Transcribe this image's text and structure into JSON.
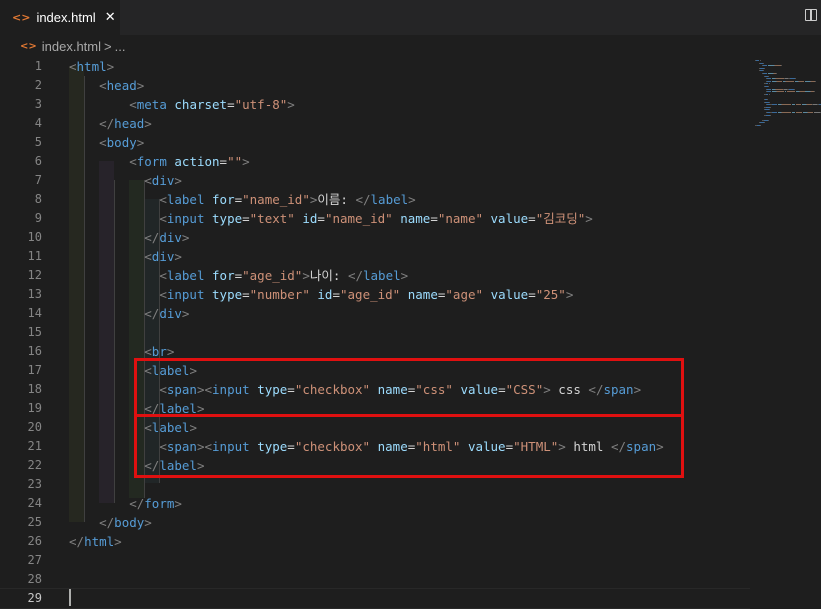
{
  "tab": {
    "icon": "html-file-icon",
    "icon_glyph": "<>",
    "label": "index.html",
    "close": "✕"
  },
  "breadcrumb": {
    "file": "index.html",
    "separator": ">",
    "more": "..."
  },
  "colors": {
    "tag": "#569cd6",
    "attr": "#9cdcfe",
    "string": "#ce9178",
    "punct": "#808080",
    "text": "#d4d4d4",
    "highlight": "#e01010"
  },
  "editor": {
    "lines": [
      {
        "n": "1",
        "tokens": [
          [
            "p",
            "<"
          ],
          [
            "t",
            "html"
          ],
          [
            "p",
            ">"
          ]
        ]
      },
      {
        "n": "2",
        "tokens": [
          [
            "x",
            "    "
          ],
          [
            "p",
            "<"
          ],
          [
            "t",
            "head"
          ],
          [
            "p",
            ">"
          ]
        ]
      },
      {
        "n": "3",
        "tokens": [
          [
            "x",
            "        "
          ],
          [
            "p",
            "<"
          ],
          [
            "t",
            "meta"
          ],
          [
            "x",
            " "
          ],
          [
            "a",
            "charset"
          ],
          [
            "x",
            "="
          ],
          [
            "s",
            "\"utf-8\""
          ],
          [
            "p",
            ">"
          ]
        ]
      },
      {
        "n": "4",
        "tokens": [
          [
            "x",
            "    "
          ],
          [
            "p",
            "</"
          ],
          [
            "t",
            "head"
          ],
          [
            "p",
            ">"
          ]
        ]
      },
      {
        "n": "5",
        "tokens": [
          [
            "x",
            "    "
          ],
          [
            "p",
            "<"
          ],
          [
            "t",
            "body"
          ],
          [
            "p",
            ">"
          ]
        ]
      },
      {
        "n": "6",
        "tokens": [
          [
            "x",
            "        "
          ],
          [
            "p",
            "<"
          ],
          [
            "t",
            "form"
          ],
          [
            "x",
            " "
          ],
          [
            "a",
            "action"
          ],
          [
            "x",
            "="
          ],
          [
            "s",
            "\"\""
          ],
          [
            "p",
            ">"
          ]
        ]
      },
      {
        "n": "7",
        "tokens": [
          [
            "x",
            "          "
          ],
          [
            "p",
            "<"
          ],
          [
            "t",
            "div"
          ],
          [
            "p",
            ">"
          ]
        ]
      },
      {
        "n": "8",
        "tokens": [
          [
            "x",
            "            "
          ],
          [
            "p",
            "<"
          ],
          [
            "t",
            "label"
          ],
          [
            "x",
            " "
          ],
          [
            "a",
            "for"
          ],
          [
            "x",
            "="
          ],
          [
            "s",
            "\"name_id\""
          ],
          [
            "p",
            ">"
          ],
          [
            "x",
            "이름: "
          ],
          [
            "p",
            "</"
          ],
          [
            "t",
            "label"
          ],
          [
            "p",
            ">"
          ]
        ]
      },
      {
        "n": "9",
        "tokens": [
          [
            "x",
            "            "
          ],
          [
            "p",
            "<"
          ],
          [
            "t",
            "input"
          ],
          [
            "x",
            " "
          ],
          [
            "a",
            "type"
          ],
          [
            "x",
            "="
          ],
          [
            "s",
            "\"text\""
          ],
          [
            "x",
            " "
          ],
          [
            "a",
            "id"
          ],
          [
            "x",
            "="
          ],
          [
            "s",
            "\"name_id\""
          ],
          [
            "x",
            " "
          ],
          [
            "a",
            "name"
          ],
          [
            "x",
            "="
          ],
          [
            "s",
            "\"name\""
          ],
          [
            "x",
            " "
          ],
          [
            "a",
            "value"
          ],
          [
            "x",
            "="
          ],
          [
            "s",
            "\"김코딩\""
          ],
          [
            "p",
            ">"
          ]
        ]
      },
      {
        "n": "10",
        "tokens": [
          [
            "x",
            "          "
          ],
          [
            "p",
            "</"
          ],
          [
            "t",
            "div"
          ],
          [
            "p",
            ">"
          ]
        ]
      },
      {
        "n": "11",
        "tokens": [
          [
            "x",
            "          "
          ],
          [
            "p",
            "<"
          ],
          [
            "t",
            "div"
          ],
          [
            "p",
            ">"
          ]
        ]
      },
      {
        "n": "12",
        "tokens": [
          [
            "x",
            "            "
          ],
          [
            "p",
            "<"
          ],
          [
            "t",
            "label"
          ],
          [
            "x",
            " "
          ],
          [
            "a",
            "for"
          ],
          [
            "x",
            "="
          ],
          [
            "s",
            "\"age_id\""
          ],
          [
            "p",
            ">"
          ],
          [
            "x",
            "나이: "
          ],
          [
            "p",
            "</"
          ],
          [
            "t",
            "label"
          ],
          [
            "p",
            ">"
          ]
        ]
      },
      {
        "n": "13",
        "tokens": [
          [
            "x",
            "            "
          ],
          [
            "p",
            "<"
          ],
          [
            "t",
            "input"
          ],
          [
            "x",
            " "
          ],
          [
            "a",
            "type"
          ],
          [
            "x",
            "="
          ],
          [
            "s",
            "\"number\""
          ],
          [
            "x",
            " "
          ],
          [
            "a",
            "id"
          ],
          [
            "x",
            "="
          ],
          [
            "s",
            "\"age_id\""
          ],
          [
            "x",
            " "
          ],
          [
            "a",
            "name"
          ],
          [
            "x",
            "="
          ],
          [
            "s",
            "\"age\""
          ],
          [
            "x",
            " "
          ],
          [
            "a",
            "value"
          ],
          [
            "x",
            "="
          ],
          [
            "s",
            "\"25\""
          ],
          [
            "p",
            ">"
          ]
        ]
      },
      {
        "n": "14",
        "tokens": [
          [
            "x",
            "          "
          ],
          [
            "p",
            "</"
          ],
          [
            "t",
            "div"
          ],
          [
            "p",
            ">"
          ]
        ]
      },
      {
        "n": "15",
        "tokens": []
      },
      {
        "n": "16",
        "tokens": [
          [
            "x",
            "          "
          ],
          [
            "p",
            "<"
          ],
          [
            "t",
            "br"
          ],
          [
            "p",
            ">"
          ]
        ]
      },
      {
        "n": "17",
        "tokens": [
          [
            "x",
            "          "
          ],
          [
            "p",
            "<"
          ],
          [
            "t",
            "label"
          ],
          [
            "p",
            ">"
          ]
        ]
      },
      {
        "n": "18",
        "tokens": [
          [
            "x",
            "            "
          ],
          [
            "p",
            "<"
          ],
          [
            "t",
            "span"
          ],
          [
            "p",
            "><"
          ],
          [
            "t",
            "input"
          ],
          [
            "x",
            " "
          ],
          [
            "a",
            "type"
          ],
          [
            "x",
            "="
          ],
          [
            "s",
            "\"checkbox\""
          ],
          [
            "x",
            " "
          ],
          [
            "a",
            "name"
          ],
          [
            "x",
            "="
          ],
          [
            "s",
            "\"css\""
          ],
          [
            "x",
            " "
          ],
          [
            "a",
            "value"
          ],
          [
            "x",
            "="
          ],
          [
            "s",
            "\"CSS\""
          ],
          [
            "p",
            ">"
          ],
          [
            "x",
            " css "
          ],
          [
            "p",
            "</"
          ],
          [
            "t",
            "span"
          ],
          [
            "p",
            ">"
          ]
        ]
      },
      {
        "n": "19",
        "tokens": [
          [
            "x",
            "          "
          ],
          [
            "p",
            "</"
          ],
          [
            "t",
            "label"
          ],
          [
            "p",
            ">"
          ]
        ]
      },
      {
        "n": "20",
        "tokens": [
          [
            "x",
            "          "
          ],
          [
            "p",
            "<"
          ],
          [
            "t",
            "label"
          ],
          [
            "p",
            ">"
          ]
        ]
      },
      {
        "n": "21",
        "tokens": [
          [
            "x",
            "            "
          ],
          [
            "p",
            "<"
          ],
          [
            "t",
            "span"
          ],
          [
            "p",
            "><"
          ],
          [
            "t",
            "input"
          ],
          [
            "x",
            " "
          ],
          [
            "a",
            "type"
          ],
          [
            "x",
            "="
          ],
          [
            "s",
            "\"checkbox\""
          ],
          [
            "x",
            " "
          ],
          [
            "a",
            "name"
          ],
          [
            "x",
            "="
          ],
          [
            "s",
            "\"html\""
          ],
          [
            "x",
            " "
          ],
          [
            "a",
            "value"
          ],
          [
            "x",
            "="
          ],
          [
            "s",
            "\"HTML\""
          ],
          [
            "p",
            ">"
          ],
          [
            "x",
            " html "
          ],
          [
            "p",
            "</"
          ],
          [
            "t",
            "span"
          ],
          [
            "p",
            ">"
          ]
        ]
      },
      {
        "n": "22",
        "tokens": [
          [
            "x",
            "          "
          ],
          [
            "p",
            "</"
          ],
          [
            "t",
            "label"
          ],
          [
            "p",
            ">"
          ]
        ]
      },
      {
        "n": "23",
        "tokens": []
      },
      {
        "n": "24",
        "tokens": [
          [
            "x",
            "        "
          ],
          [
            "p",
            "</"
          ],
          [
            "t",
            "form"
          ],
          [
            "p",
            ">"
          ]
        ]
      },
      {
        "n": "25",
        "tokens": [
          [
            "x",
            "    "
          ],
          [
            "p",
            "</"
          ],
          [
            "t",
            "body"
          ],
          [
            "p",
            ">"
          ]
        ]
      },
      {
        "n": "26",
        "tokens": [
          [
            "p",
            "</"
          ],
          [
            "t",
            "html"
          ],
          [
            "p",
            ">"
          ]
        ]
      },
      {
        "n": "27",
        "tokens": []
      },
      {
        "n": "28",
        "tokens": []
      },
      {
        "n": "29",
        "tokens": []
      }
    ]
  }
}
